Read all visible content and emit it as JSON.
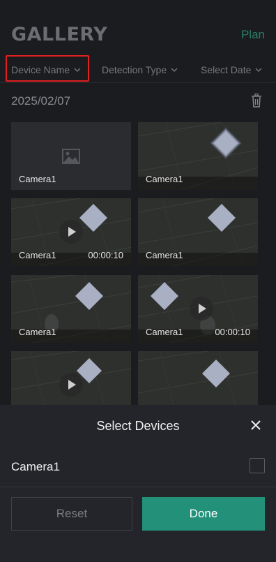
{
  "header": {
    "title": "GALLERY",
    "plan_link": "Plan"
  },
  "filters": {
    "device_name": "Device Name",
    "detection_type": "Detection Type",
    "select_date": "Select Date"
  },
  "date_group": {
    "date": "2025/02/07",
    "delete_icon": "trash-icon"
  },
  "tiles": [
    {
      "camera": "Camera1",
      "duration": "",
      "type": "placeholder"
    },
    {
      "camera": "Camera1",
      "duration": "",
      "type": "image"
    },
    {
      "camera": "Camera1",
      "duration": "00:00:10",
      "type": "video"
    },
    {
      "camera": "Camera1",
      "duration": "",
      "type": "image"
    },
    {
      "camera": "Camera1",
      "duration": "",
      "type": "image"
    },
    {
      "camera": "Camera1",
      "duration": "00:00:10",
      "type": "video"
    },
    {
      "camera": "",
      "duration": "",
      "type": "video"
    },
    {
      "camera": "",
      "duration": "",
      "type": "image"
    }
  ],
  "sheet": {
    "title": "Select Devices",
    "devices": [
      {
        "name": "Camera1",
        "checked": false
      }
    ],
    "reset_label": "Reset",
    "done_label": "Done"
  },
  "colors": {
    "accent": "#23917a",
    "highlight": "#e01f1f",
    "background": "#1b1c1f"
  }
}
